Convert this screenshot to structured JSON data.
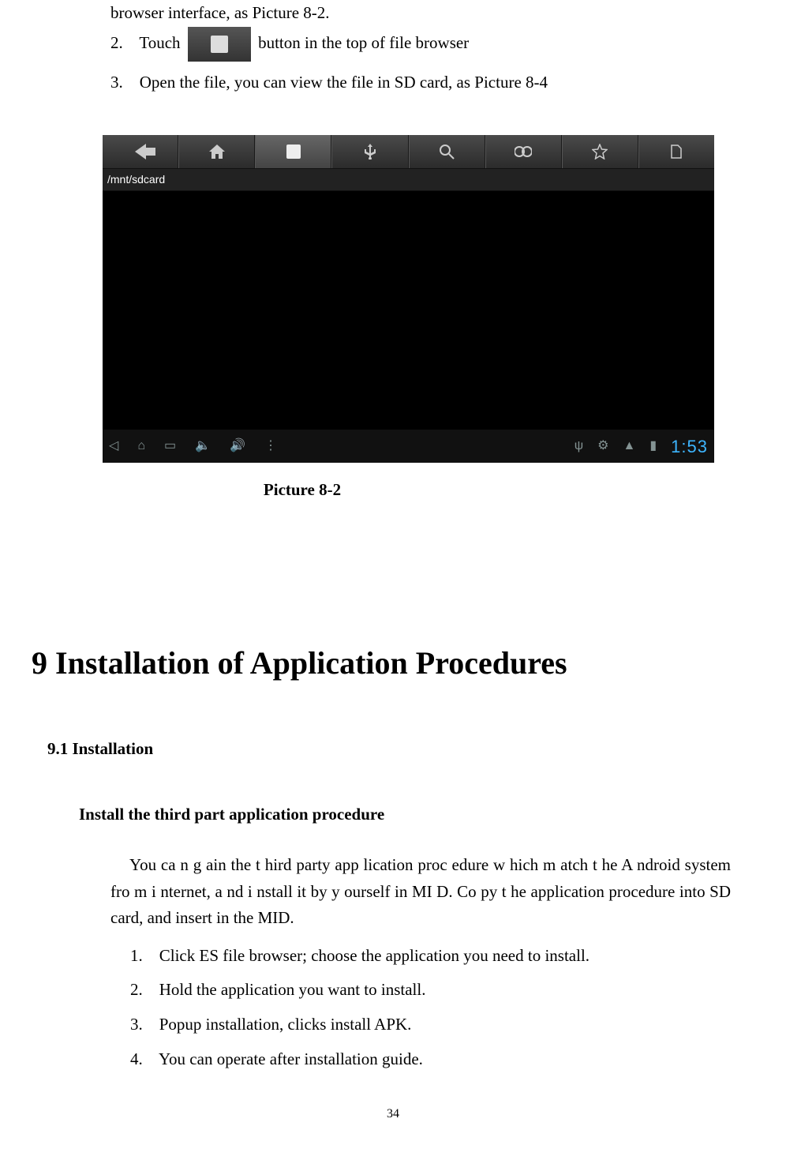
{
  "intro": {
    "line1": "browser interface, as Picture 8-2.",
    "item2_prefix": "2.",
    "item2_before": "Touch",
    "item2_after": "button in the top of file browser",
    "item3_prefix": "3.",
    "item3": "Open the file, you can view the file in SD card, as Picture 8-4"
  },
  "screenshot": {
    "path": "/mnt/sdcard",
    "clock": "1:53",
    "toolbar_icons": [
      "back",
      "home",
      "sdcard",
      "usb",
      "search",
      "film",
      "star",
      "page"
    ]
  },
  "caption": "Picture 8-2",
  "section9": {
    "title": "9 Installation of Application Procedures",
    "sub": "9.1 Installation",
    "subsub": "Install the third part application procedure",
    "body": "You ca n g ain the  t hird  party app lication proc edure w hich m atch t he A ndroid system fro m i nternet, a nd i nstall  it by  y ourself in  MI D. Co py t he  application procedure into SD card, and insert in the MID.",
    "steps": {
      "s1_num": "1.",
      "s1": "Click ES file browser; choose the application you need to install.",
      "s2_num": "2.",
      "s2": "Hold the application you want to install.",
      "s3_num": "3.",
      "s3": "Popup installation, clicks install APK.",
      "s4_num": "4.",
      "s4": "You can operate after installation guide."
    }
  },
  "page_number": "34"
}
